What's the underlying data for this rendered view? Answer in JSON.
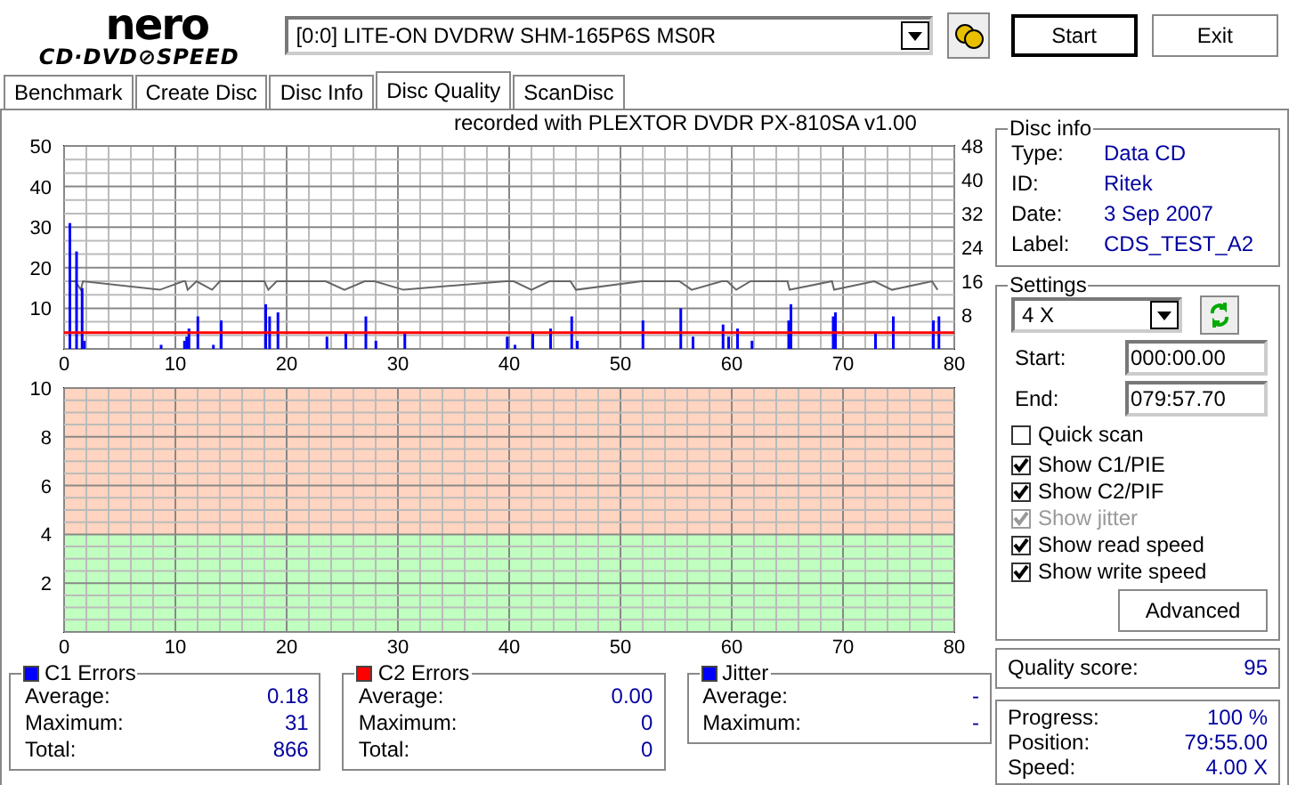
{
  "header": {
    "drive": "[0:0]  LITE-ON DVDRW SHM-165P6S MS0R",
    "start": "Start",
    "exit": "Exit"
  },
  "logo": {
    "top": "nero",
    "bottom": "CD·DVD⊘SPEED"
  },
  "tabs": [
    {
      "label": "Benchmark",
      "selected": false
    },
    {
      "label": "Create Disc",
      "selected": false
    },
    {
      "label": "Disc Info",
      "selected": false
    },
    {
      "label": "Disc Quality",
      "selected": true
    },
    {
      "label": "ScanDisc",
      "selected": false
    }
  ],
  "recorded_with": "recorded with PLEXTOR DVDR   PX-810SA  v1.00",
  "error_chart": {
    "chart_data": {
      "type": "bar",
      "xlim": [
        0,
        80
      ],
      "ylim": [
        0,
        50
      ],
      "xticks": [
        0,
        10,
        20,
        30,
        40,
        50,
        60,
        70,
        80
      ],
      "yticks": [
        10,
        20,
        30,
        40,
        50
      ],
      "y2ticks": [
        8,
        16,
        24,
        32,
        40,
        48
      ],
      "x": [
        0.4,
        1.0,
        1.5,
        1.7,
        8.6,
        10.7,
        10.9,
        11.1,
        11.9,
        13.3,
        14,
        18,
        18.35,
        19.1,
        23.5,
        25.2,
        27,
        27.9,
        30.5,
        39.7,
        40.4,
        42,
        43.6,
        45.5,
        46,
        51.9,
        55.3,
        56.4,
        59.1,
        59.6,
        60.4,
        61.7,
        65,
        65.2,
        69,
        69.2,
        72.8,
        74.4,
        78,
        78.5
      ],
      "y2lim": [
        0,
        48
      ],
      "grid": true,
      "series": [
        {
          "color": "#0000ff",
          "values": [
            31,
            24,
            15,
            2,
            1,
            2,
            3,
            5,
            8,
            1,
            7,
            11,
            8,
            9,
            3,
            4,
            8,
            2,
            4,
            3,
            1,
            4,
            5,
            8,
            2,
            7,
            10,
            3,
            6,
            3,
            5,
            2,
            7,
            11,
            8,
            9,
            4,
            8,
            7,
            8
          ]
        },
        {
          "color": "#666666",
          "type": "line",
          "axis": "y2",
          "values": [
            16,
            16,
            14,
            16,
            14,
            16,
            16,
            14,
            16,
            14,
            16,
            16,
            14,
            16,
            16,
            14,
            16,
            16,
            14,
            16,
            16,
            14,
            16,
            16,
            14,
            16,
            16,
            14,
            16,
            16,
            14,
            16,
            16,
            14,
            16,
            14,
            16,
            14,
            16,
            14
          ]
        }
      ],
      "ref_lines": [
        {
          "axis": "y",
          "value": 4,
          "color": "#ff0000"
        }
      ]
    }
  },
  "jitter_chart": {
    "chart_data": {
      "type": "line",
      "xlim": [
        0,
        80
      ],
      "ylim": [
        0,
        10
      ],
      "xticks": [
        0,
        10,
        20,
        30,
        40,
        50,
        60,
        70,
        80
      ],
      "yticks": [
        2,
        4,
        6,
        8,
        10
      ],
      "grid": true,
      "bands": [
        {
          "axis": "y",
          "from": 0,
          "to": 4,
          "color": "#c0ffc0"
        },
        {
          "axis": "y",
          "from": 4,
          "to": 10,
          "color": "#ffd4c0"
        }
      ]
    }
  },
  "stats": [
    {
      "title": "C1 Errors",
      "color": "#0000ff",
      "rows": [
        {
          "label": "Average:",
          "value": "0.18"
        },
        {
          "label": "Maximum:",
          "value": "31"
        },
        {
          "label": "Total:",
          "value": "866"
        }
      ]
    },
    {
      "title": "C2 Errors",
      "color": "#ff0000",
      "rows": [
        {
          "label": "Average:",
          "value": "0.00"
        },
        {
          "label": "Maximum:",
          "value": "0"
        },
        {
          "label": "Total:",
          "value": "0"
        }
      ]
    },
    {
      "title": "Jitter",
      "color": "#0000ff",
      "rows": [
        {
          "label": "Average:",
          "value": "-"
        },
        {
          "label": "Maximum:",
          "value": "-"
        }
      ]
    }
  ],
  "disc_info": {
    "title": "Disc info",
    "rows": [
      {
        "label": "Type:",
        "value": "Data CD"
      },
      {
        "label": "ID:",
        "value": "Ritek"
      },
      {
        "label": "Date:",
        "value": "3 Sep 2007"
      },
      {
        "label": "Label:",
        "value": "CDS_TEST_A2"
      }
    ]
  },
  "settings": {
    "title": "Settings",
    "speed": "4 X",
    "start_label": "Start:",
    "start": "000:00.00",
    "end_label": "End:",
    "end": "079:57.70",
    "options": [
      {
        "label": "Quick scan",
        "checked": false,
        "disabled": false
      },
      {
        "label": "Show C1/PIE",
        "checked": true,
        "disabled": false
      },
      {
        "label": "Show C2/PIF",
        "checked": true,
        "disabled": false
      },
      {
        "label": "Show jitter",
        "checked": true,
        "disabled": true
      },
      {
        "label": "Show read speed",
        "checked": true,
        "disabled": false
      },
      {
        "label": "Show write speed",
        "checked": true,
        "disabled": false
      }
    ],
    "advanced": "Advanced"
  },
  "quality": {
    "label": "Quality score:",
    "value": "95"
  },
  "progress": [
    {
      "label": "Progress:",
      "value": "100 %"
    },
    {
      "label": "Position:",
      "value": "79:55.00"
    },
    {
      "label": "Speed:",
      "value": "4.00 X"
    }
  ]
}
